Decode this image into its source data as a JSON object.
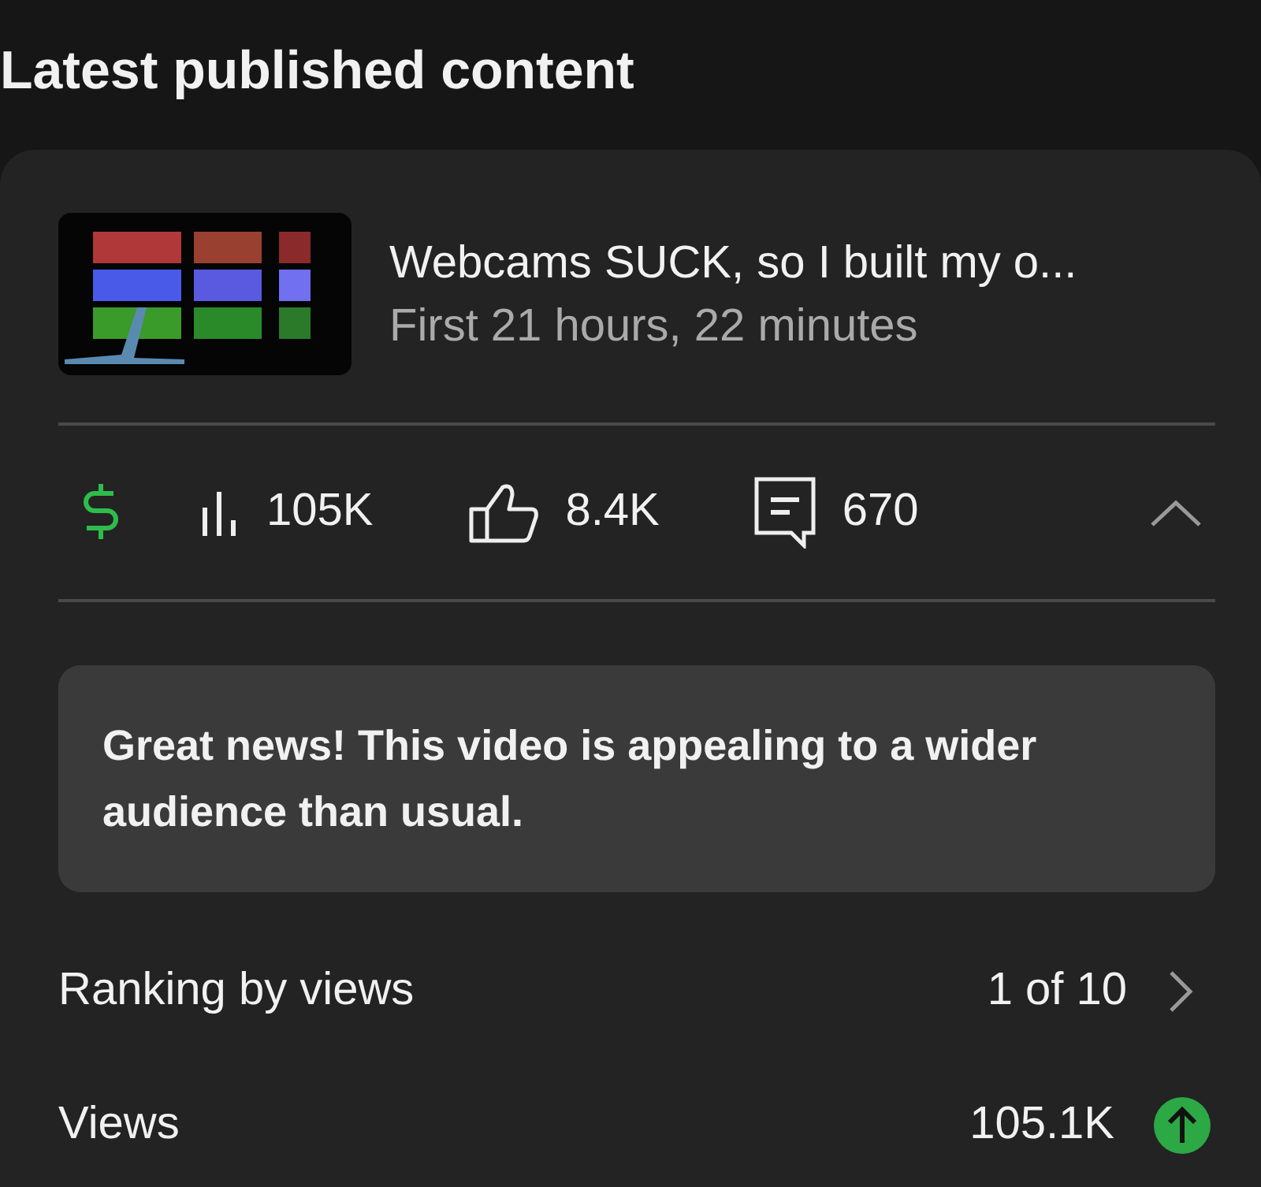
{
  "heading": "Latest published content",
  "video": {
    "title": "Webcams SUCK, so I built my o...",
    "age": "First 21 hours, 22 minutes"
  },
  "stats": [
    {
      "kind": "monetization"
    },
    {
      "kind": "views",
      "value": "105K"
    },
    {
      "kind": "likes",
      "value": "8.4K"
    },
    {
      "kind": "comments",
      "value": "670"
    }
  ],
  "expanded": true,
  "message": "Great news! This video is appealing to a wider audience than usual.",
  "metrics": [
    {
      "kind": "ranking",
      "label": "Ranking by views",
      "value": "1 of 10"
    },
    {
      "kind": "trend",
      "label": "Views",
      "value": "105.1K",
      "rising": true
    }
  ]
}
